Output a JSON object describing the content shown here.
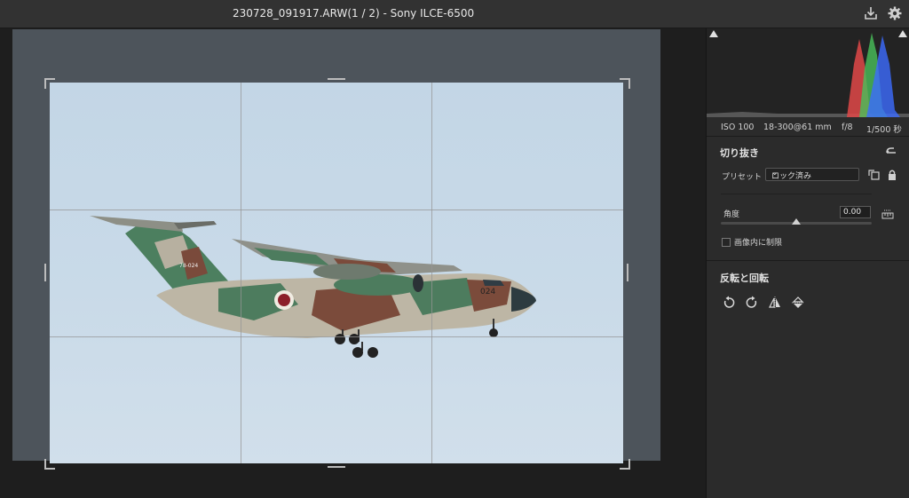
{
  "window": {
    "title": "230728_091917.ARW(1 / 2)  -  Sony ILCE-6500"
  },
  "toolbar": {
    "icons": [
      "save-icon",
      "gear-icon"
    ]
  },
  "histogram": {
    "colors": {
      "red": "#e04848",
      "green": "#49c15a",
      "blue": "#3c6bff"
    }
  },
  "exif": {
    "iso": "ISO 100",
    "lens": "18-300@61 mm",
    "aperture": "f/8",
    "shutter": "1/500 秒"
  },
  "crop": {
    "section_title": "切り抜き",
    "preset_label": "プリセット",
    "preset_value": "ロック済み",
    "angle_label": "角度",
    "angle_value": "0.00",
    "angle_level": 0.5,
    "constrain_label": "画像内に制限",
    "constrain_checked": false
  },
  "transform": {
    "section_title": "反転と回転",
    "icons": [
      "rotate-left-icon",
      "rotate-right-icon",
      "flip-horizontal-icon",
      "flip-vertical-icon"
    ]
  },
  "photo": {
    "tail_text": "78-024",
    "nose_text": "024",
    "sky_color": "#c6d8e7"
  }
}
